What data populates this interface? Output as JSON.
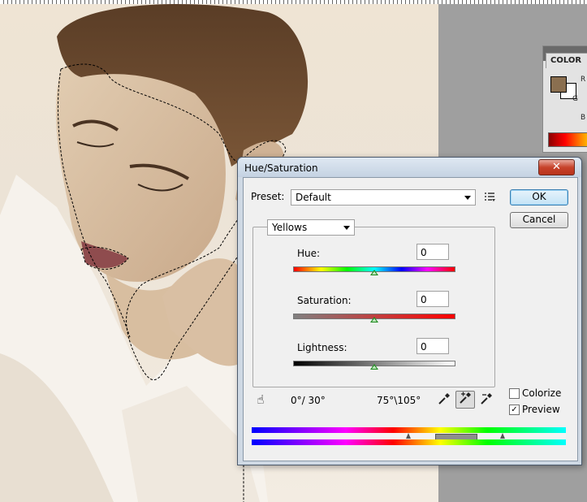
{
  "color_panel": {
    "tab_label": "COLOR",
    "foreground_color": "#8a6f50",
    "background_color": "#ffffff",
    "channels": [
      "R",
      "G",
      "B"
    ]
  },
  "dialog": {
    "title": "Hue/Saturation",
    "close_glyph": "✕",
    "preset_label": "Preset:",
    "preset_value": "Default",
    "ok_label": "OK",
    "cancel_label": "Cancel",
    "edit_channel": "Yellows",
    "hue_label": "Hue:",
    "hue_value": "0",
    "saturation_label": "Saturation:",
    "saturation_value": "0",
    "lightness_label": "Lightness:",
    "lightness_value": "0",
    "range_left": "0°/ 30°",
    "range_right": "75°\\105°",
    "colorize_label": "Colorize",
    "colorize_checked": false,
    "preview_label": "Preview",
    "preview_checked": true,
    "hue_slider_level": 0.5,
    "saturation_slider_level": 0.5,
    "lightness_slider_level": 0.5
  },
  "icons": {
    "targeted_adjustment": "hand-icon",
    "eyedropper": "eyedropper-icon",
    "eyedropper_add": "eyedropper-plus-icon",
    "eyedropper_subtract": "eyedropper-minus-icon",
    "preset_options": "preset-menu-icon"
  }
}
